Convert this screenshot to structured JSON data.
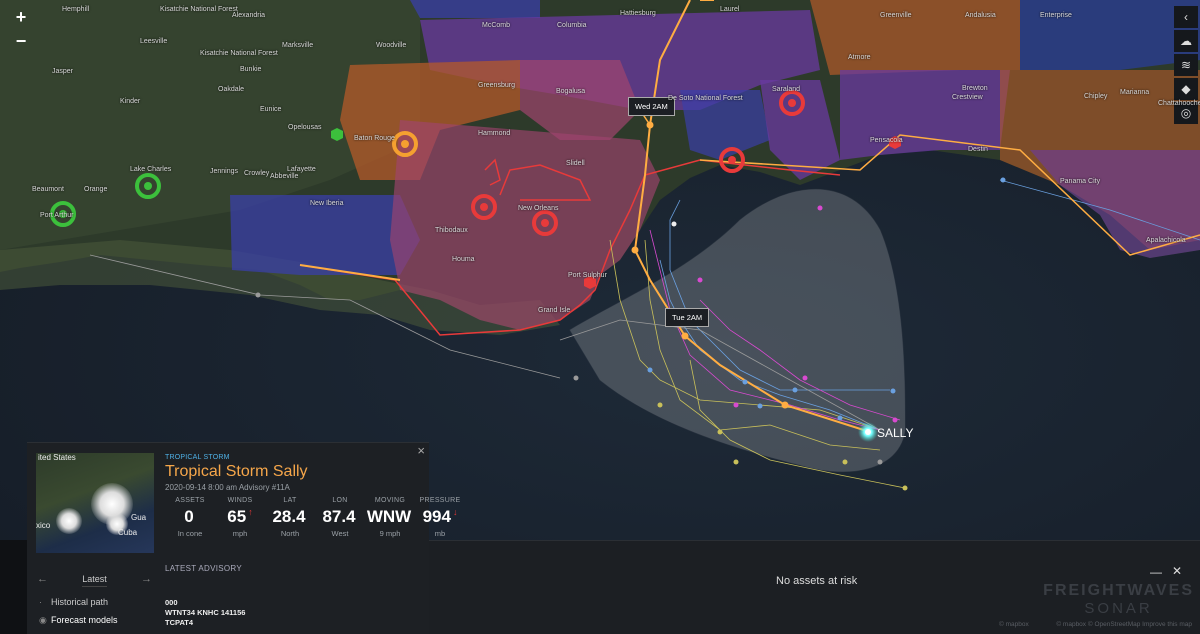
{
  "map": {
    "zoom_in": "+",
    "zoom_out": "−",
    "right_tools": [
      "‹",
      "☁",
      "≋",
      "◆",
      "◎"
    ],
    "place_labels": [
      "Kisatchie National Forest",
      "Alexandria",
      "Kisatchie National Forest",
      "Leesville",
      "Hemphill",
      "Jasper",
      "Woodville",
      "McComb",
      "Columbia",
      "Hattiesburg",
      "Laurel",
      "Enterprise",
      "Andalusia",
      "Greenville",
      "Brewton",
      "Atmore",
      "Baton Rouge",
      "Opelousas",
      "Lafayette",
      "Crowley",
      "Jennings",
      "Lake Charles",
      "Beaumont",
      "Orange",
      "Port Arthur",
      "Hammond",
      "Bogalusa",
      "Slidell",
      "New Orleans",
      "Thibodaux",
      "Houma",
      "Abbeville",
      "New Iberia",
      "Port Sulphur",
      "Grand Isle",
      "Saraland",
      "Pensacola",
      "Crestview",
      "Chipley",
      "Marianna",
      "Chattahoochee",
      "Panama City",
      "Apalachicola",
      "Destin",
      "De Soto National Forest",
      "Oakdale",
      "Bunkie",
      "Marksville",
      "Eunice",
      "Greensburg",
      "Kinder"
    ],
    "track_labels": [
      "Wed 2AM",
      "Tue 2AM"
    ],
    "storm_label": "SALLY",
    "colors": {
      "cone": "#dcdcdc",
      "track": "#ffad42",
      "warning": "#e83a3a",
      "region_purple": "#6a3aa0",
      "region_blue": "#3a3fa8",
      "region_orange": "#b45a2a",
      "region_pink": "#a0446e"
    }
  },
  "panel": {
    "kicker": "TROPICAL STORM",
    "title": "Tropical Storm Sally",
    "subtitle": "2020-09-14 8:00 am Advisory #11A",
    "stats": [
      {
        "label": "ASSETS",
        "value": "0",
        "unit": "In cone",
        "trend": ""
      },
      {
        "label": "WINDS",
        "value": "65",
        "unit": "mph",
        "trend": "↑"
      },
      {
        "label": "LAT",
        "value": "28.4",
        "unit": "North",
        "trend": ""
      },
      {
        "label": "LON",
        "value": "87.4",
        "unit": "West",
        "trend": ""
      },
      {
        "label": "MOVING",
        "value": "WNW",
        "unit": "9 mph",
        "trend": ""
      },
      {
        "label": "PRESSURE",
        "value": "994",
        "unit": "mb",
        "trend": "↓"
      }
    ],
    "thumb_labels": [
      "ited States",
      "xico",
      "Cuba",
      "Gua"
    ],
    "nav_prev": "←",
    "nav_current": "Latest",
    "nav_next": "→",
    "options": [
      {
        "label": "Historical path",
        "icon": "·"
      },
      {
        "label": "Forecast models",
        "icon": "◉"
      }
    ],
    "latest_advisory_heading": "LATEST ADVISORY",
    "advisory_lines": [
      "000",
      "WTNT34 KNHC 141156",
      "TCPAT4"
    ],
    "close": "×"
  },
  "bottom": {
    "message": "No assets at risk",
    "minimize": "—",
    "close": "✕",
    "brand_line1": "FREIGHTWAVES",
    "brand_line2": "SONAR",
    "attribution": "© mapbox",
    "credits": "© mapbox © OpenStreetMap Improve this map"
  }
}
